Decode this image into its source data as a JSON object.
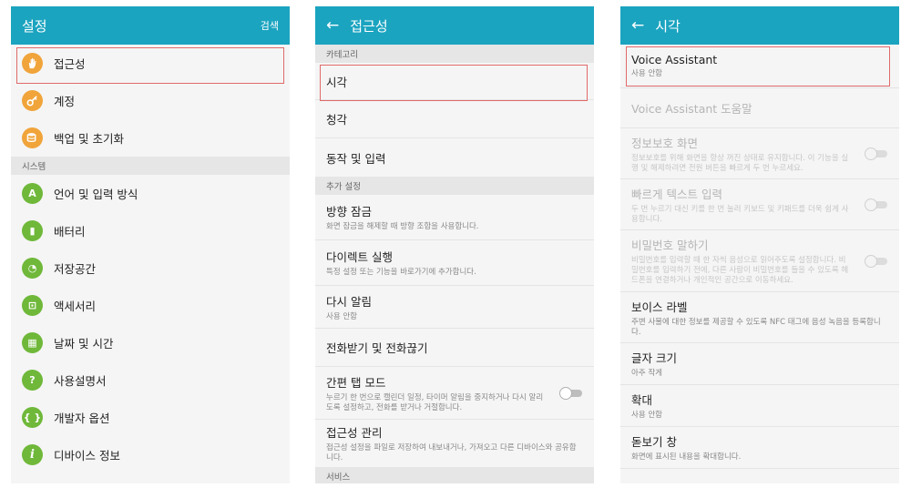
{
  "settings": {
    "title": "설정",
    "search_label": "검색",
    "items": [
      {
        "label": "접근성",
        "icon": "hand-icon"
      },
      {
        "label": "계정",
        "icon": "key-icon"
      },
      {
        "label": "백업 및 초기화",
        "icon": "backup-icon"
      }
    ],
    "system_header": "시스템",
    "system_items": [
      {
        "label": "언어 및 입력 방식",
        "icon": "language-icon",
        "glyph": "A"
      },
      {
        "label": "배터리",
        "icon": "battery-icon",
        "glyph": "▮"
      },
      {
        "label": "저장공간",
        "icon": "storage-icon",
        "glyph": "◔"
      },
      {
        "label": "액세서리",
        "icon": "accessory-icon",
        "glyph": "⊡"
      },
      {
        "label": "날짜 및 시간",
        "icon": "calendar-icon",
        "glyph": "▦"
      },
      {
        "label": "사용설명서",
        "icon": "manual-icon",
        "glyph": "?"
      },
      {
        "label": "개발자 옵션",
        "icon": "developer-icon",
        "glyph": "{ }"
      },
      {
        "label": "디바이스 정보",
        "icon": "info-icon",
        "glyph": "i"
      }
    ]
  },
  "accessibility": {
    "title": "접근성",
    "category_header": "카테고리",
    "category_items": [
      {
        "label": "시각"
      },
      {
        "label": "청각"
      },
      {
        "label": "동작 및 입력"
      }
    ],
    "extra_header": "추가 설정",
    "extra_items": [
      {
        "label": "방향 잠금",
        "sub": "화면 잠금을 해제할 때 방향 조합을 사용합니다."
      },
      {
        "label": "다이렉트 실행",
        "sub": "특정 설정 또는 기능을 바로가기에 추가합니다."
      },
      {
        "label": "다시 알림",
        "sub": "사용 안함"
      },
      {
        "label": "전화받기 및 전화끊기"
      },
      {
        "label": "간편 탭 모드",
        "sub": "누르기 한 번으로 캘린더 일정, 타이머 알림을 중지하거나 다시 알리도록 설정하고, 전화를 받거나 거절합니다."
      },
      {
        "label": "접근성 관리",
        "sub": "접근성 설정을 파일로 저장하여 내보내거나, 가져오고 다른 디바이스와 공유합니다."
      }
    ],
    "service_header": "서비스"
  },
  "vision": {
    "title": "시각",
    "items": [
      {
        "label": "Voice Assistant",
        "sub": "사용 안함"
      },
      {
        "label": "Voice Assistant 도움말"
      },
      {
        "label": "정보보호 화면",
        "sub": "정보보호를 위해 화면을 항상 꺼진 상태로 유지합니다. 이 기능을 실행 및 해제하려면 전원 버튼을 빠르게 두 번 누르세요."
      },
      {
        "label": "빠르게 텍스트 입력",
        "sub": "두 번 누르기 대신 키를 한 번 눌러 키보드 및 키패드를 더욱 쉽게 사용합니다."
      },
      {
        "label": "비밀번호 말하기",
        "sub": "비밀번호를 입력할 때 한 자씩 음성으로 읽어주도록 설정합니다. 비밀번호를 입력하기 전에, 다른 사람이 비밀번호를 들을 수 있도록 헤드폰을 연결하거나 개인적인 공간으로 이동하세요."
      },
      {
        "label": "보이스 라벨",
        "sub": "주변 사물에 대한 정보를 제공할 수 있도록 NFC 태그에 음성 녹음을 등록합니다."
      },
      {
        "label": "글자 크기",
        "sub": "아주 작게"
      },
      {
        "label": "확대",
        "sub": "사용 안함"
      },
      {
        "label": "돋보기 창",
        "sub": "화면에 표시된 내용을 확대합니다."
      }
    ]
  },
  "colors": {
    "accent": "#1ba4c0",
    "highlight": "#e06a6a",
    "icon_orange": "#f0a43a",
    "icon_green": "#6fb83a"
  }
}
